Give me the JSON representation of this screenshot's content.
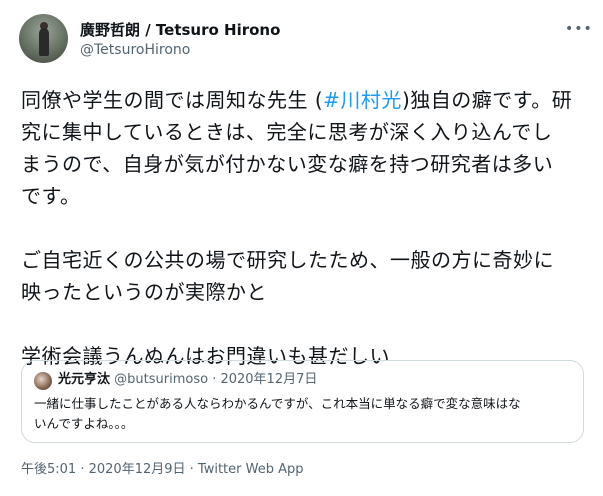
{
  "author": {
    "display_name": "廣野哲朗 / Tetsuro Hirono",
    "handle": "@TetsuroHirono"
  },
  "more_icon": "more-horizontal-icon",
  "tweet": {
    "line1_before": "同僚や学生の間では周知な先生 (",
    "hashtag": "#川村光",
    "line1_after": ")独自の癖です。研",
    "line2": "究に集中しているときは、完全に思考が深く入り込んでし",
    "line3": "まうので、自身が気が付かない変な癖を持つ研究者は多い",
    "line4": "です。",
    "line5": "ご自宅近くの公共の場で研究したため、一般の方に奇妙に",
    "line6": "映ったというのが実際かと",
    "line7": "学術会議うんぬんはお門違いも甚だしい"
  },
  "quoted_tweet": {
    "display_name": "光元亨汰",
    "handle": "@butsurimoso",
    "separator": " · ",
    "date": "2020年12月7日",
    "line1": "一緒に仕事したことがある人ならわかるんですが、これ本当に単なる癖で変な意味はな",
    "line2": "いんですよね。。。"
  },
  "footer": {
    "time": "午後5:01",
    "sep1": " · ",
    "date": "2020年12月9日",
    "sep2": " · ",
    "client": "Twitter Web App"
  },
  "colors": {
    "link": "#1d9bf0",
    "secondary_text": "#536471",
    "border": "#cfd9de"
  }
}
